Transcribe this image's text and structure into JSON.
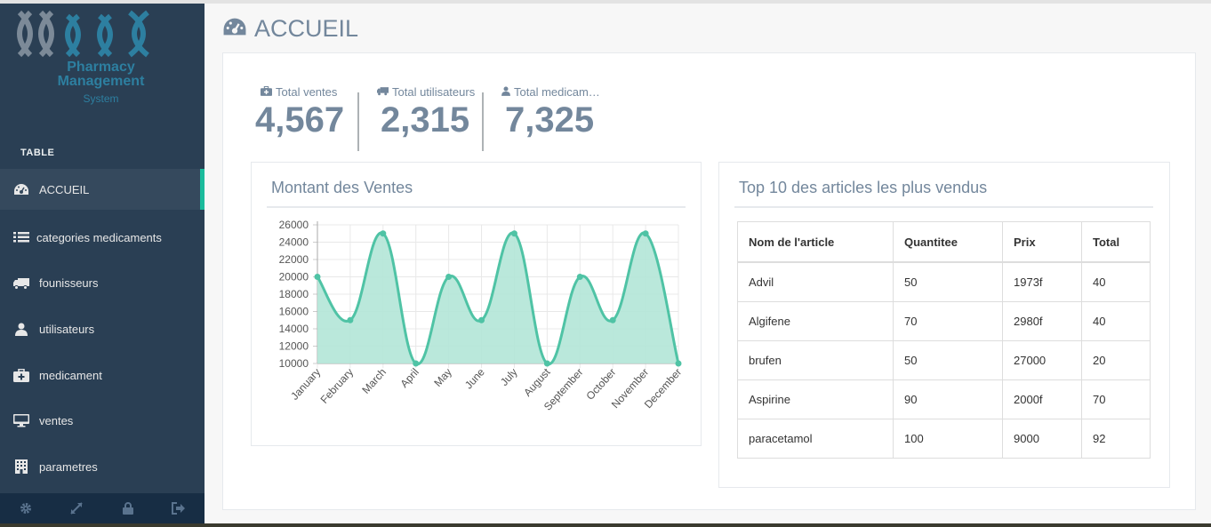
{
  "sidebar": {
    "logo_line1": "Pharmacy",
    "logo_line2": "Management",
    "logo_line3": "System",
    "section": "TABLE",
    "items": [
      {
        "label": "ACCUEIL",
        "icon": "dashboard-icon"
      },
      {
        "label": "categories medicaments",
        "icon": "list-icon"
      },
      {
        "label": "founisseurs",
        "icon": "truck-icon"
      },
      {
        "label": "utilisateurs",
        "icon": "user-icon"
      },
      {
        "label": "medicament",
        "icon": "medkit-icon"
      },
      {
        "label": "ventes",
        "icon": "desktop-icon"
      },
      {
        "label": "parametres",
        "icon": "building-icon"
      }
    ],
    "footer_icons": [
      "gear-icon",
      "fullscreen-icon",
      "lock-icon",
      "sign-out-icon"
    ]
  },
  "page": {
    "title": "ACCUEIL"
  },
  "stats": [
    {
      "label": "Total ventes",
      "value": "4,567",
      "icon": "medkit-icon"
    },
    {
      "label": "Total utilisateurs",
      "value": "2,315",
      "icon": "truck-icon"
    },
    {
      "label": "Total medicam…",
      "value": "7,325",
      "icon": "user-icon"
    }
  ],
  "sales_chart": {
    "title": "Montant des Ventes"
  },
  "top_table": {
    "title": "Top 10 des articles les plus vendus",
    "headers": [
      "Nom de l'article",
      "Quantitee",
      "Prix",
      "Total"
    ],
    "rows": [
      [
        "Advil",
        "50",
        "1973f",
        "40"
      ],
      [
        "Algifene",
        "70",
        "2980f",
        "40"
      ],
      [
        "brufen",
        "50",
        "27000",
        "20"
      ],
      [
        "Aspirine",
        "90",
        "2000f",
        "70"
      ],
      [
        "paracetamol",
        "100",
        "9000",
        "92"
      ]
    ]
  },
  "colors": {
    "sidebar": "#2a3f54",
    "accent": "#1abb9c",
    "series_line": "#4fc3a5",
    "series_fill": "#b3e5d7",
    "text_muted": "#73879c"
  },
  "chart_data": {
    "type": "area",
    "categories": [
      "January",
      "February",
      "March",
      "April",
      "May",
      "June",
      "July",
      "August",
      "September",
      "October",
      "November",
      "December"
    ],
    "values": [
      20000,
      15000,
      25000,
      10000,
      20000,
      15000,
      25000,
      10000,
      20000,
      15000,
      25000,
      10000
    ],
    "yticks": [
      "26000",
      "24000",
      "22000",
      "20000",
      "18000",
      "16000",
      "14000",
      "12000",
      "10000"
    ],
    "ylim": [
      10000,
      26000
    ],
    "grid": true
  }
}
